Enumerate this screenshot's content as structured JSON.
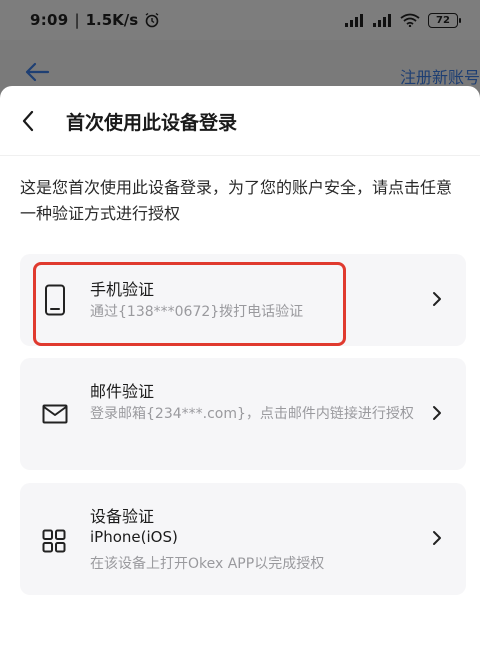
{
  "status_bar": {
    "time": "9:09",
    "network_speed": "1.5K/s",
    "battery": "72"
  },
  "underlying_page": {
    "register_link": "注册新账号"
  },
  "sheet": {
    "title": "首次使用此设备登录",
    "description": "这是您首次使用此设备登录，为了您的账户安全，请点击任意一种验证方式进行授权",
    "options": [
      {
        "icon": "phone-icon",
        "title": "手机验证",
        "subtitle": "通过{138***0672}拨打电话验证"
      },
      {
        "icon": "mail-icon",
        "title": "邮件验证",
        "subtitle": "登录邮箱{234***.com}，点击邮件内链接进行授权"
      },
      {
        "icon": "grid-icon",
        "title": "设备验证",
        "device": "iPhone(iOS)",
        "subtitle": "在该设备上打开Okex APP以完成授权"
      }
    ]
  },
  "colors": {
    "highlight": "#e03a2f",
    "card_bg": "#f6f6f8",
    "link": "#1e3f73"
  }
}
